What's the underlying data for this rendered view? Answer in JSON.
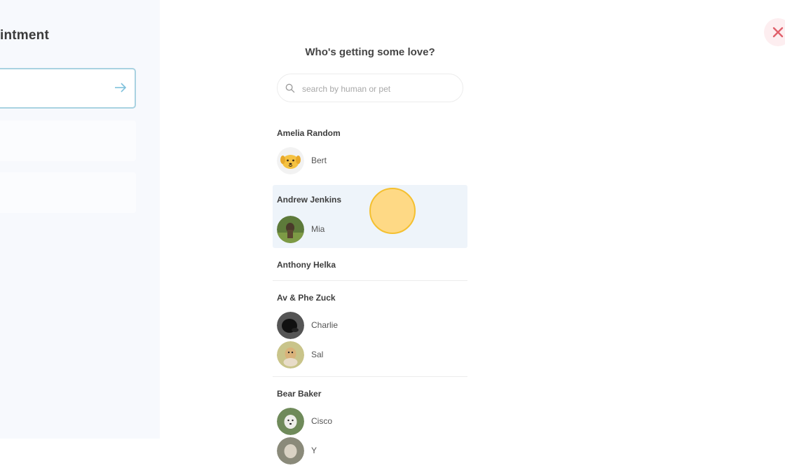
{
  "left_panel": {
    "title": "intment"
  },
  "modal": {
    "heading": "Who's getting some love?",
    "search": {
      "placeholder": "search by human or pet",
      "value": ""
    },
    "owners": [
      {
        "name": "Amelia Random",
        "pets": [
          {
            "name": "Bert",
            "avatar": "dog-cartoon-avatar"
          }
        ]
      },
      {
        "name": "Andrew Jenkins",
        "pets": [
          {
            "name": "Mia",
            "avatar": "dog-photo-avatar"
          }
        ]
      },
      {
        "name": "Anthony Helka",
        "pets": []
      },
      {
        "name": "Av & Phe Zuck",
        "pets": [
          {
            "name": "Charlie",
            "avatar": "dog-photo-avatar"
          },
          {
            "name": "Sal",
            "avatar": "dog-photo-avatar"
          }
        ]
      },
      {
        "name": "Bear Baker",
        "pets": [
          {
            "name": "Cisco",
            "avatar": "dog-photo-avatar"
          },
          {
            "name": "Y",
            "avatar": "dog-photo-avatar"
          }
        ]
      }
    ]
  },
  "colors": {
    "accent_border": "#a9d2e1",
    "highlight_row": "#eef4fa",
    "close_icon": "#e0606b",
    "cursor_fill": "#ffd678"
  },
  "icons": [
    "arrow-right-icon",
    "close-icon",
    "search-icon"
  ]
}
